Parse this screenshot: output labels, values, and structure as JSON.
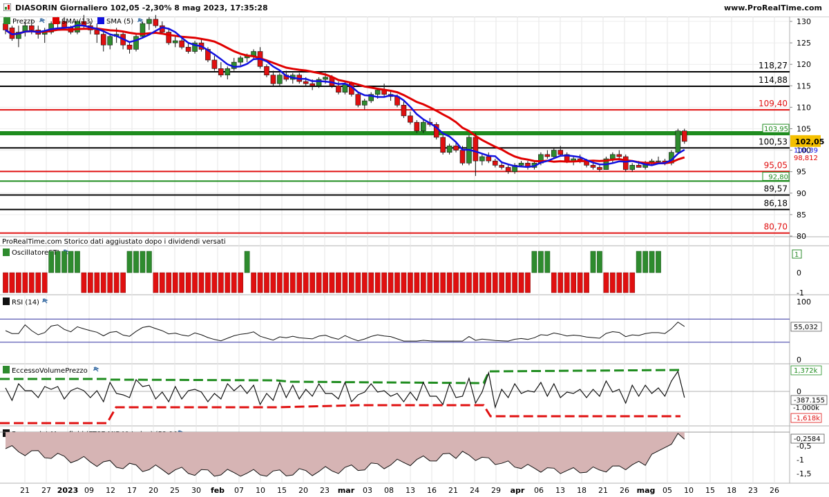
{
  "header": {
    "title": "DIASORIN Giornaliero 102,05 -2,30% 8 mag 2023, 17:35:28",
    "site": "www.ProRealTime.com"
  },
  "colors": {
    "up": "#2e8b2e",
    "down": "#e01010",
    "sma13": "#e00000",
    "sma5": "#1010e0",
    "grid": "#dcdcdc",
    "green_level": "#1e8c1e",
    "red_level": "#e01010"
  },
  "panels": {
    "price": {
      "legend": [
        "Prezzo",
        "SMA (13)",
        "SMA (5)"
      ],
      "note": "ProRealTime.com  Storico dati aggiustato dopo i dividendi versati",
      "ticks": [
        "130",
        "125",
        "120",
        "115",
        "110",
        "105",
        "100",
        "95",
        "90",
        "85",
        "80"
      ],
      "levels": [
        {
          "value": 118.27,
          "label": "118,27",
          "color": "#000000",
          "kind": "black"
        },
        {
          "value": 114.88,
          "label": "114,88",
          "color": "#000000",
          "kind": "black"
        },
        {
          "value": 109.4,
          "label": "109,40",
          "color": "#e01010",
          "kind": "red"
        },
        {
          "value": 103.95,
          "label": "103,95",
          "color": "#1e8c1e",
          "kind": "green"
        },
        {
          "value": 100.53,
          "label": "100,53",
          "color": "#000000",
          "kind": "black"
        },
        {
          "value": 95.05,
          "label": "95,05",
          "color": "#e01010",
          "kind": "red"
        },
        {
          "value": 92.8,
          "label": "92,80",
          "color": "#1e8c1e",
          "kind": "green"
        },
        {
          "value": 89.57,
          "label": "89,57",
          "color": "#000000",
          "kind": "black"
        },
        {
          "value": 86.18,
          "label": "86,18",
          "color": "#000000",
          "kind": "black"
        },
        {
          "value": 80.7,
          "label": "80,70",
          "color": "#e01010",
          "kind": "red"
        }
      ],
      "last_price": "102,05",
      "sma5_value": "100,39",
      "sma13_value": "98,812"
    },
    "sti": {
      "legend": "OscillatoreSTI",
      "ticks": [
        "1",
        "0",
        "-1"
      ]
    },
    "rsi": {
      "legend": "RSI (14)",
      "ticks": [
        "100",
        "0"
      ],
      "value": "55,032"
    },
    "evp": {
      "legend": "EccessoVolumePrezzo",
      "ticks": [
        "0",
        "-1.000k"
      ],
      "upper": "1,372k",
      "value": "-387.155",
      "lower": "-1,618k"
    },
    "mansfield": {
      "legend": "Forza relat Mansfield (FTSE MIB40 Index) (52 10)",
      "ticks": [
        "-0,5",
        "-1",
        "-1,5"
      ],
      "value": "-0,2584"
    }
  },
  "xaxis": [
    {
      "label": "21",
      "bold": false
    },
    {
      "label": "27",
      "bold": false
    },
    {
      "label": "2023",
      "bold": true
    },
    {
      "label": "09",
      "bold": false
    },
    {
      "label": "12",
      "bold": false
    },
    {
      "label": "17",
      "bold": false
    },
    {
      "label": "20",
      "bold": false
    },
    {
      "label": "25",
      "bold": false
    },
    {
      "label": "30",
      "bold": false
    },
    {
      "label": "feb",
      "bold": true
    },
    {
      "label": "07",
      "bold": false
    },
    {
      "label": "10",
      "bold": false
    },
    {
      "label": "15",
      "bold": false
    },
    {
      "label": "20",
      "bold": false
    },
    {
      "label": "23",
      "bold": false
    },
    {
      "label": "mar",
      "bold": true
    },
    {
      "label": "03",
      "bold": false
    },
    {
      "label": "08",
      "bold": false
    },
    {
      "label": "13",
      "bold": false
    },
    {
      "label": "16",
      "bold": false
    },
    {
      "label": "21",
      "bold": false
    },
    {
      "label": "24",
      "bold": false
    },
    {
      "label": "29",
      "bold": false
    },
    {
      "label": "apr",
      "bold": true
    },
    {
      "label": "06",
      "bold": false
    },
    {
      "label": "13",
      "bold": false
    },
    {
      "label": "18",
      "bold": false
    },
    {
      "label": "21",
      "bold": false
    },
    {
      "label": "26",
      "bold": false
    },
    {
      "label": "mag",
      "bold": true
    },
    {
      "label": "05",
      "bold": false
    },
    {
      "label": "10",
      "bold": false
    },
    {
      "label": "15",
      "bold": false
    },
    {
      "label": "18",
      "bold": false
    },
    {
      "label": "23",
      "bold": false
    },
    {
      "label": "26",
      "bold": false
    }
  ],
  "chart_data": {
    "type": "candlestick",
    "ohlc": [
      [
        129.5,
        131.0,
        127.0,
        128.0
      ],
      [
        128.5,
        129.0,
        125.5,
        126.0
      ],
      [
        126.0,
        129.0,
        124.0,
        127.5
      ],
      [
        127.5,
        130.0,
        126.5,
        129.0
      ],
      [
        129.0,
        130.5,
        127.0,
        128.0
      ],
      [
        128.0,
        129.0,
        126.0,
        127.0
      ],
      [
        127.0,
        128.5,
        125.0,
        127.5
      ],
      [
        127.5,
        130.0,
        127.0,
        129.5
      ],
      [
        129.5,
        131.0,
        128.5,
        130.0
      ],
      [
        130.0,
        131.0,
        128.0,
        128.5
      ],
      [
        128.5,
        129.0,
        127.0,
        127.5
      ],
      [
        127.5,
        130.5,
        127.0,
        130.0
      ],
      [
        130.0,
        131.5,
        128.5,
        129.0
      ],
      [
        129.0,
        130.0,
        127.0,
        128.0
      ],
      [
        128.0,
        129.5,
        125.0,
        127.0
      ],
      [
        127.0,
        127.5,
        123.0,
        124.5
      ],
      [
        124.5,
        127.0,
        123.5,
        126.5
      ],
      [
        126.5,
        128.5,
        125.0,
        127.0
      ],
      [
        127.0,
        127.5,
        123.5,
        124.5
      ],
      [
        124.5,
        125.0,
        122.5,
        123.5
      ],
      [
        123.5,
        127.0,
        123.0,
        126.5
      ],
      [
        126.5,
        130.0,
        126.0,
        129.5
      ],
      [
        129.5,
        131.0,
        128.0,
        130.5
      ],
      [
        130.5,
        131.5,
        128.5,
        129.0
      ],
      [
        129.0,
        130.0,
        127.0,
        127.5
      ],
      [
        127.5,
        128.5,
        124.5,
        125.0
      ],
      [
        125.0,
        126.5,
        124.0,
        125.5
      ],
      [
        125.5,
        126.0,
        123.5,
        124.0
      ],
      [
        124.0,
        125.0,
        122.5,
        123.0
      ],
      [
        123.0,
        125.5,
        122.5,
        125.0
      ],
      [
        125.0,
        126.0,
        123.0,
        123.5
      ],
      [
        123.5,
        124.0,
        120.5,
        121.0
      ],
      [
        121.0,
        122.0,
        118.5,
        119.0
      ],
      [
        119.0,
        120.5,
        117.0,
        117.5
      ],
      [
        117.5,
        119.5,
        116.5,
        119.0
      ],
      [
        119.0,
        121.5,
        118.5,
        120.5
      ],
      [
        120.5,
        122.0,
        119.5,
        121.5
      ],
      [
        121.5,
        122.5,
        120.5,
        122.0
      ],
      [
        122.0,
        123.5,
        121.0,
        123.0
      ],
      [
        123.0,
        124.0,
        119.0,
        119.5
      ],
      [
        119.5,
        120.0,
        117.0,
        117.5
      ],
      [
        117.5,
        118.5,
        115.0,
        115.5
      ],
      [
        115.5,
        118.0,
        115.0,
        117.5
      ],
      [
        117.5,
        118.5,
        116.0,
        116.5
      ],
      [
        116.5,
        118.0,
        115.5,
        117.5
      ],
      [
        117.5,
        118.0,
        115.5,
        116.0
      ],
      [
        116.0,
        117.0,
        115.0,
        115.5
      ],
      [
        115.5,
        116.5,
        114.0,
        115.0
      ],
      [
        115.0,
        117.0,
        114.5,
        116.5
      ],
      [
        116.5,
        118.0,
        115.5,
        117.0
      ],
      [
        117.0,
        117.5,
        114.5,
        115.0
      ],
      [
        115.0,
        116.0,
        113.0,
        113.5
      ],
      [
        113.5,
        116.0,
        113.0,
        115.5
      ],
      [
        115.5,
        116.0,
        112.5,
        113.0
      ],
      [
        113.0,
        113.5,
        110.0,
        110.5
      ],
      [
        110.5,
        112.0,
        109.5,
        111.5
      ],
      [
        111.5,
        113.5,
        111.0,
        113.0
      ],
      [
        113.0,
        114.5,
        112.0,
        114.0
      ],
      [
        114.0,
        115.5,
        112.5,
        113.0
      ],
      [
        113.0,
        114.0,
        111.5,
        112.5
      ],
      [
        112.5,
        113.0,
        110.0,
        110.5
      ],
      [
        110.5,
        111.5,
        107.5,
        108.0
      ],
      [
        108.0,
        109.0,
        106.0,
        106.5
      ],
      [
        106.5,
        107.0,
        104.0,
        104.5
      ],
      [
        104.5,
        107.0,
        104.0,
        106.5
      ],
      [
        106.5,
        107.5,
        105.5,
        106.0
      ],
      [
        106.0,
        106.5,
        102.5,
        103.0
      ],
      [
        103.0,
        103.5,
        99.0,
        99.5
      ],
      [
        99.5,
        101.5,
        99.0,
        101.0
      ],
      [
        101.0,
        102.0,
        99.5,
        100.0
      ],
      [
        100.0,
        101.0,
        96.5,
        97.0
      ],
      [
        97.0,
        103.5,
        96.5,
        103.0
      ],
      [
        103.0,
        104.0,
        94.0,
        97.5
      ],
      [
        97.5,
        99.0,
        96.5,
        98.5
      ],
      [
        98.5,
        99.5,
        97.0,
        97.5
      ],
      [
        97.5,
        98.0,
        96.0,
        96.5
      ],
      [
        96.5,
        97.0,
        95.5,
        96.0
      ],
      [
        96.0,
        96.5,
        94.5,
        95.0
      ],
      [
        95.0,
        97.0,
        94.5,
        96.5
      ],
      [
        96.5,
        97.5,
        96.0,
        97.0
      ],
      [
        97.0,
        97.5,
        95.5,
        96.0
      ],
      [
        96.0,
        97.5,
        95.5,
        97.0
      ],
      [
        97.0,
        99.5,
        96.5,
        99.0
      ],
      [
        99.0,
        100.0,
        98.0,
        98.5
      ],
      [
        98.5,
        100.5,
        98.0,
        100.0
      ],
      [
        100.0,
        101.0,
        98.5,
        99.0
      ],
      [
        99.0,
        99.5,
        97.0,
        97.5
      ],
      [
        97.5,
        98.5,
        96.5,
        98.0
      ],
      [
        98.0,
        99.0,
        97.0,
        97.5
      ],
      [
        97.5,
        98.0,
        96.0,
        96.5
      ],
      [
        96.5,
        97.0,
        95.5,
        96.0
      ],
      [
        96.0,
        96.5,
        95.0,
        95.5
      ],
      [
        95.5,
        98.5,
        95.5,
        98.0
      ],
      [
        98.0,
        99.5,
        97.0,
        99.0
      ],
      [
        99.0,
        100.0,
        98.0,
        98.5
      ],
      [
        98.5,
        99.0,
        95.0,
        95.5
      ],
      [
        95.5,
        97.0,
        95.0,
        96.5
      ],
      [
        96.5,
        97.5,
        96.0,
        96.0
      ],
      [
        96.0,
        97.5,
        95.5,
        97.0
      ],
      [
        97.0,
        98.0,
        96.5,
        97.5
      ],
      [
        97.5,
        98.5,
        97.0,
        97.5
      ],
      [
        97.5,
        98.0,
        96.5,
        97.0
      ],
      [
        97.0,
        100.0,
        96.5,
        99.5
      ],
      [
        99.5,
        105.0,
        99.0,
        104.5
      ],
      [
        104.5,
        105.0,
        101.5,
        102.05
      ]
    ],
    "sti": [
      -1,
      -1,
      -1,
      -1,
      -1,
      -1,
      -1,
      1,
      1,
      1,
      1,
      1,
      -1,
      -1,
      -1,
      -1,
      -1,
      -1,
      -1,
      1,
      1,
      1,
      1,
      -1,
      -1,
      -1,
      -1,
      -1,
      -1,
      -1,
      -1,
      -1,
      -1,
      -1,
      -1,
      -1,
      -1,
      1,
      -1,
      -1,
      -1,
      -1,
      -1,
      -1,
      -1,
      -1,
      -1,
      -1,
      -1,
      -1,
      -1,
      -1,
      -1,
      -1,
      -1,
      -1,
      -1,
      -1,
      -1,
      -1,
      -1,
      -1,
      -1,
      -1,
      -1,
      -1,
      -1,
      -1,
      -1,
      -1,
      -1,
      -1,
      -1,
      -1,
      -1,
      -1,
      -1,
      -1,
      -1,
      -1,
      -1,
      1,
      1,
      1,
      -1,
      -1,
      -1,
      -1,
      -1,
      -1,
      1,
      1,
      -1,
      -1,
      -1,
      -1,
      -1,
      1,
      1,
      1,
      1
    ],
    "rsi_range": [
      0,
      100
    ],
    "rsi_bands": [
      70,
      30
    ]
  }
}
